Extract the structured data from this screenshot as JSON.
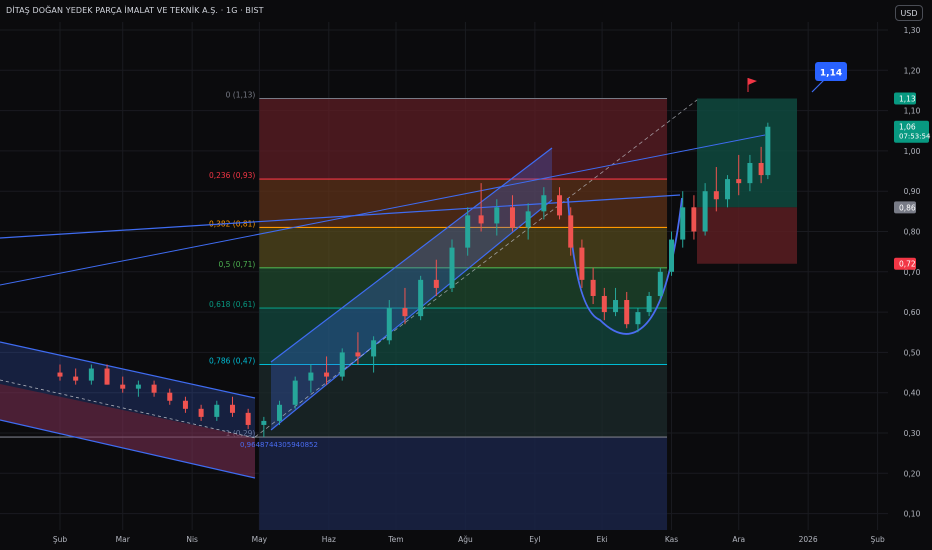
{
  "header": {
    "title": "DİTAŞ DOĞAN YEDEK PARÇA İMALAT VE TEKNİK A.Ş. · 1G · BIST",
    "currency": "USD"
  },
  "colors": {
    "background": "#0b0b0d",
    "up": "#26a69a",
    "down": "#ef5350",
    "channel": "#3f6cf2",
    "fib0": "#787b86",
    "fib236": "#f23645",
    "fib382": "#ff9800",
    "fib5": "#4caf50",
    "fib618": "#089981",
    "fib786": "#00bcd4",
    "fib1": "#787b86"
  },
  "chart_data": {
    "type": "candlestick",
    "ylim": [
      0.07,
      1.33
    ],
    "y_ticks": [
      "1,30",
      "1,20",
      "1,10",
      "1,00",
      "0,90",
      "0,80",
      "0,70",
      "0,60",
      "0,50",
      "0,40",
      "0,30",
      "0,20",
      "0,10"
    ],
    "y_tick_values": [
      1.3,
      1.2,
      1.1,
      1.0,
      0.9,
      0.8,
      0.7,
      0.6,
      0.5,
      0.4,
      0.3,
      0.2,
      0.1
    ],
    "x_ticks": [
      "Şub",
      "Mar",
      "Nis",
      "May",
      "Haz",
      "Tem",
      "Ağu",
      "Eyl",
      "Eki",
      "Kas",
      "Ara",
      "2026",
      "Şub"
    ],
    "x_tick_days": [
      0,
      28,
      59,
      89,
      120,
      150,
      181,
      212,
      242,
      273,
      303,
      334,
      365
    ],
    "price_labels": [
      {
        "value": 1.13,
        "text": "1,13",
        "color": "#089981"
      },
      {
        "value": 1.06,
        "text": "1,06",
        "sub": "07:53:54",
        "color": "#089981"
      },
      {
        "value": 0.86,
        "text": "0,86",
        "color": "#787b86"
      },
      {
        "value": 0.72,
        "text": "0,72",
        "color": "#f23645"
      }
    ],
    "fib_levels": [
      {
        "ratio": "0",
        "value": 1.13,
        "label": "0 (1,13)"
      },
      {
        "ratio": "0.236",
        "value": 0.93,
        "label": "0,236 (0,93)"
      },
      {
        "ratio": "0.382",
        "value": 0.81,
        "label": "0,382 (0,81)"
      },
      {
        "ratio": "0.5",
        "value": 0.71,
        "label": "0,5 (0,71)"
      },
      {
        "ratio": "0.618",
        "value": 0.61,
        "label": "0,618 (0,61)"
      },
      {
        "ratio": "0.786",
        "value": 0.47,
        "label": "0,786 (0,47)"
      },
      {
        "ratio": "1",
        "value": 0.29,
        "label": "1 (0,29)"
      }
    ],
    "fib_start_day": 89,
    "fib_end_day": 271,
    "target_label": "1,14",
    "annotation": "0,9648744305940852",
    "candles": [
      {
        "d": 0,
        "o": 0.45,
        "h": 0.47,
        "l": 0.43,
        "c": 0.44
      },
      {
        "d": 7,
        "o": 0.44,
        "h": 0.46,
        "l": 0.42,
        "c": 0.43
      },
      {
        "d": 14,
        "o": 0.43,
        "h": 0.47,
        "l": 0.42,
        "c": 0.46
      },
      {
        "d": 21,
        "o": 0.46,
        "h": 0.47,
        "l": 0.42,
        "c": 0.42
      },
      {
        "d": 28,
        "o": 0.42,
        "h": 0.44,
        "l": 0.4,
        "c": 0.41
      },
      {
        "d": 35,
        "o": 0.41,
        "h": 0.43,
        "l": 0.39,
        "c": 0.42
      },
      {
        "d": 42,
        "o": 0.42,
        "h": 0.43,
        "l": 0.39,
        "c": 0.4
      },
      {
        "d": 49,
        "o": 0.4,
        "h": 0.41,
        "l": 0.37,
        "c": 0.38
      },
      {
        "d": 56,
        "o": 0.38,
        "h": 0.39,
        "l": 0.35,
        "c": 0.36
      },
      {
        "d": 63,
        "o": 0.36,
        "h": 0.37,
        "l": 0.33,
        "c": 0.34
      },
      {
        "d": 70,
        "o": 0.34,
        "h": 0.38,
        "l": 0.33,
        "c": 0.37
      },
      {
        "d": 77,
        "o": 0.37,
        "h": 0.39,
        "l": 0.34,
        "c": 0.35
      },
      {
        "d": 84,
        "o": 0.35,
        "h": 0.36,
        "l": 0.31,
        "c": 0.32
      },
      {
        "d": 91,
        "o": 0.32,
        "h": 0.34,
        "l": 0.29,
        "c": 0.33
      },
      {
        "d": 98,
        "o": 0.33,
        "h": 0.38,
        "l": 0.32,
        "c": 0.37
      },
      {
        "d": 105,
        "o": 0.37,
        "h": 0.44,
        "l": 0.36,
        "c": 0.43
      },
      {
        "d": 112,
        "o": 0.43,
        "h": 0.47,
        "l": 0.4,
        "c": 0.45
      },
      {
        "d": 119,
        "o": 0.45,
        "h": 0.49,
        "l": 0.42,
        "c": 0.44
      },
      {
        "d": 126,
        "o": 0.44,
        "h": 0.51,
        "l": 0.43,
        "c": 0.5
      },
      {
        "d": 133,
        "o": 0.5,
        "h": 0.55,
        "l": 0.47,
        "c": 0.49
      },
      {
        "d": 140,
        "o": 0.49,
        "h": 0.54,
        "l": 0.45,
        "c": 0.53
      },
      {
        "d": 147,
        "o": 0.53,
        "h": 0.63,
        "l": 0.52,
        "c": 0.61
      },
      {
        "d": 154,
        "o": 0.61,
        "h": 0.66,
        "l": 0.57,
        "c": 0.59
      },
      {
        "d": 161,
        "o": 0.59,
        "h": 0.69,
        "l": 0.58,
        "c": 0.68
      },
      {
        "d": 168,
        "o": 0.68,
        "h": 0.73,
        "l": 0.64,
        "c": 0.66
      },
      {
        "d": 175,
        "o": 0.66,
        "h": 0.78,
        "l": 0.65,
        "c": 0.76
      },
      {
        "d": 182,
        "o": 0.76,
        "h": 0.86,
        "l": 0.74,
        "c": 0.84
      },
      {
        "d": 188,
        "o": 0.84,
        "h": 0.92,
        "l": 0.8,
        "c": 0.82
      },
      {
        "d": 195,
        "o": 0.82,
        "h": 0.88,
        "l": 0.79,
        "c": 0.86
      },
      {
        "d": 202,
        "o": 0.86,
        "h": 0.89,
        "l": 0.8,
        "c": 0.81
      },
      {
        "d": 209,
        "o": 0.81,
        "h": 0.87,
        "l": 0.78,
        "c": 0.85
      },
      {
        "d": 216,
        "o": 0.85,
        "h": 0.91,
        "l": 0.83,
        "c": 0.89
      },
      {
        "d": 223,
        "o": 0.89,
        "h": 0.91,
        "l": 0.83,
        "c": 0.84
      },
      {
        "d": 228,
        "o": 0.84,
        "h": 0.86,
        "l": 0.74,
        "c": 0.76
      },
      {
        "d": 233,
        "o": 0.76,
        "h": 0.78,
        "l": 0.66,
        "c": 0.68
      },
      {
        "d": 238,
        "o": 0.68,
        "h": 0.71,
        "l": 0.62,
        "c": 0.64
      },
      {
        "d": 243,
        "o": 0.64,
        "h": 0.66,
        "l": 0.58,
        "c": 0.6
      },
      {
        "d": 248,
        "o": 0.6,
        "h": 0.66,
        "l": 0.59,
        "c": 0.63
      },
      {
        "d": 253,
        "o": 0.63,
        "h": 0.65,
        "l": 0.56,
        "c": 0.57
      },
      {
        "d": 258,
        "o": 0.57,
        "h": 0.61,
        "l": 0.55,
        "c": 0.6
      },
      {
        "d": 263,
        "o": 0.6,
        "h": 0.65,
        "l": 0.59,
        "c": 0.64
      },
      {
        "d": 268,
        "o": 0.64,
        "h": 0.71,
        "l": 0.63,
        "c": 0.7
      },
      {
        "d": 273,
        "o": 0.7,
        "h": 0.8,
        "l": 0.69,
        "c": 0.78
      },
      {
        "d": 278,
        "o": 0.78,
        "h": 0.9,
        "l": 0.76,
        "c": 0.86
      },
      {
        "d": 283,
        "o": 0.86,
        "h": 0.89,
        "l": 0.78,
        "c": 0.8
      },
      {
        "d": 288,
        "o": 0.8,
        "h": 0.92,
        "l": 0.79,
        "c": 0.9
      },
      {
        "d": 293,
        "o": 0.9,
        "h": 0.96,
        "l": 0.85,
        "c": 0.88
      },
      {
        "d": 298,
        "o": 0.88,
        "h": 0.94,
        "l": 0.86,
        "c": 0.93
      },
      {
        "d": 303,
        "o": 0.93,
        "h": 0.99,
        "l": 0.89,
        "c": 0.92
      },
      {
        "d": 308,
        "o": 0.92,
        "h": 0.99,
        "l": 0.9,
        "c": 0.97
      },
      {
        "d": 313,
        "o": 0.97,
        "h": 1.01,
        "l": 0.92,
        "c": 0.94
      },
      {
        "d": 316,
        "o": 0.94,
        "h": 1.07,
        "l": 0.93,
        "c": 1.06
      }
    ]
  }
}
